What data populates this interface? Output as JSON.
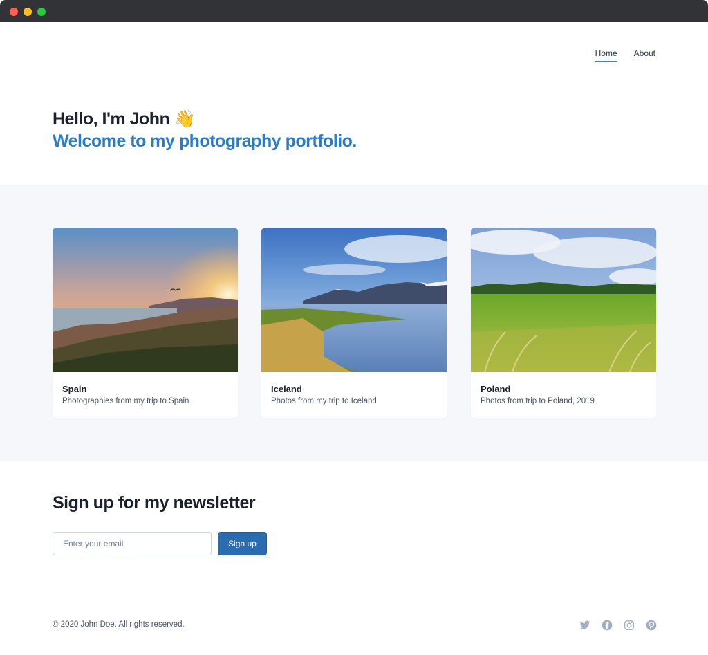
{
  "window": {
    "controls": [
      "close",
      "minimize",
      "maximize"
    ]
  },
  "nav": {
    "items": [
      {
        "label": "Home",
        "active": true
      },
      {
        "label": "About",
        "active": false
      }
    ]
  },
  "hero": {
    "greeting": "Hello, I'm John 👋",
    "tagline": "Welcome to my photography portfolio."
  },
  "gallery": {
    "cards": [
      {
        "title": "Spain",
        "description": "Photographies from my trip to Spain"
      },
      {
        "title": "Iceland",
        "description": "Photos from my trip to Iceland"
      },
      {
        "title": "Poland",
        "description": "Photos from trip to Poland, 2019"
      }
    ]
  },
  "newsletter": {
    "heading": "Sign up for my newsletter",
    "email_placeholder": "Enter your email",
    "button_label": "Sign up"
  },
  "footer": {
    "copyright": "© 2020 John Doe. All rights reserved.",
    "social_icons": [
      "twitter-icon",
      "facebook-icon",
      "instagram-icon",
      "pinterest-icon"
    ]
  },
  "colors": {
    "accent": "#2b7bc8",
    "button": "#2b6cb0",
    "gallery_bg": "#f5f7fa",
    "social_icon": "#a0aec0"
  }
}
